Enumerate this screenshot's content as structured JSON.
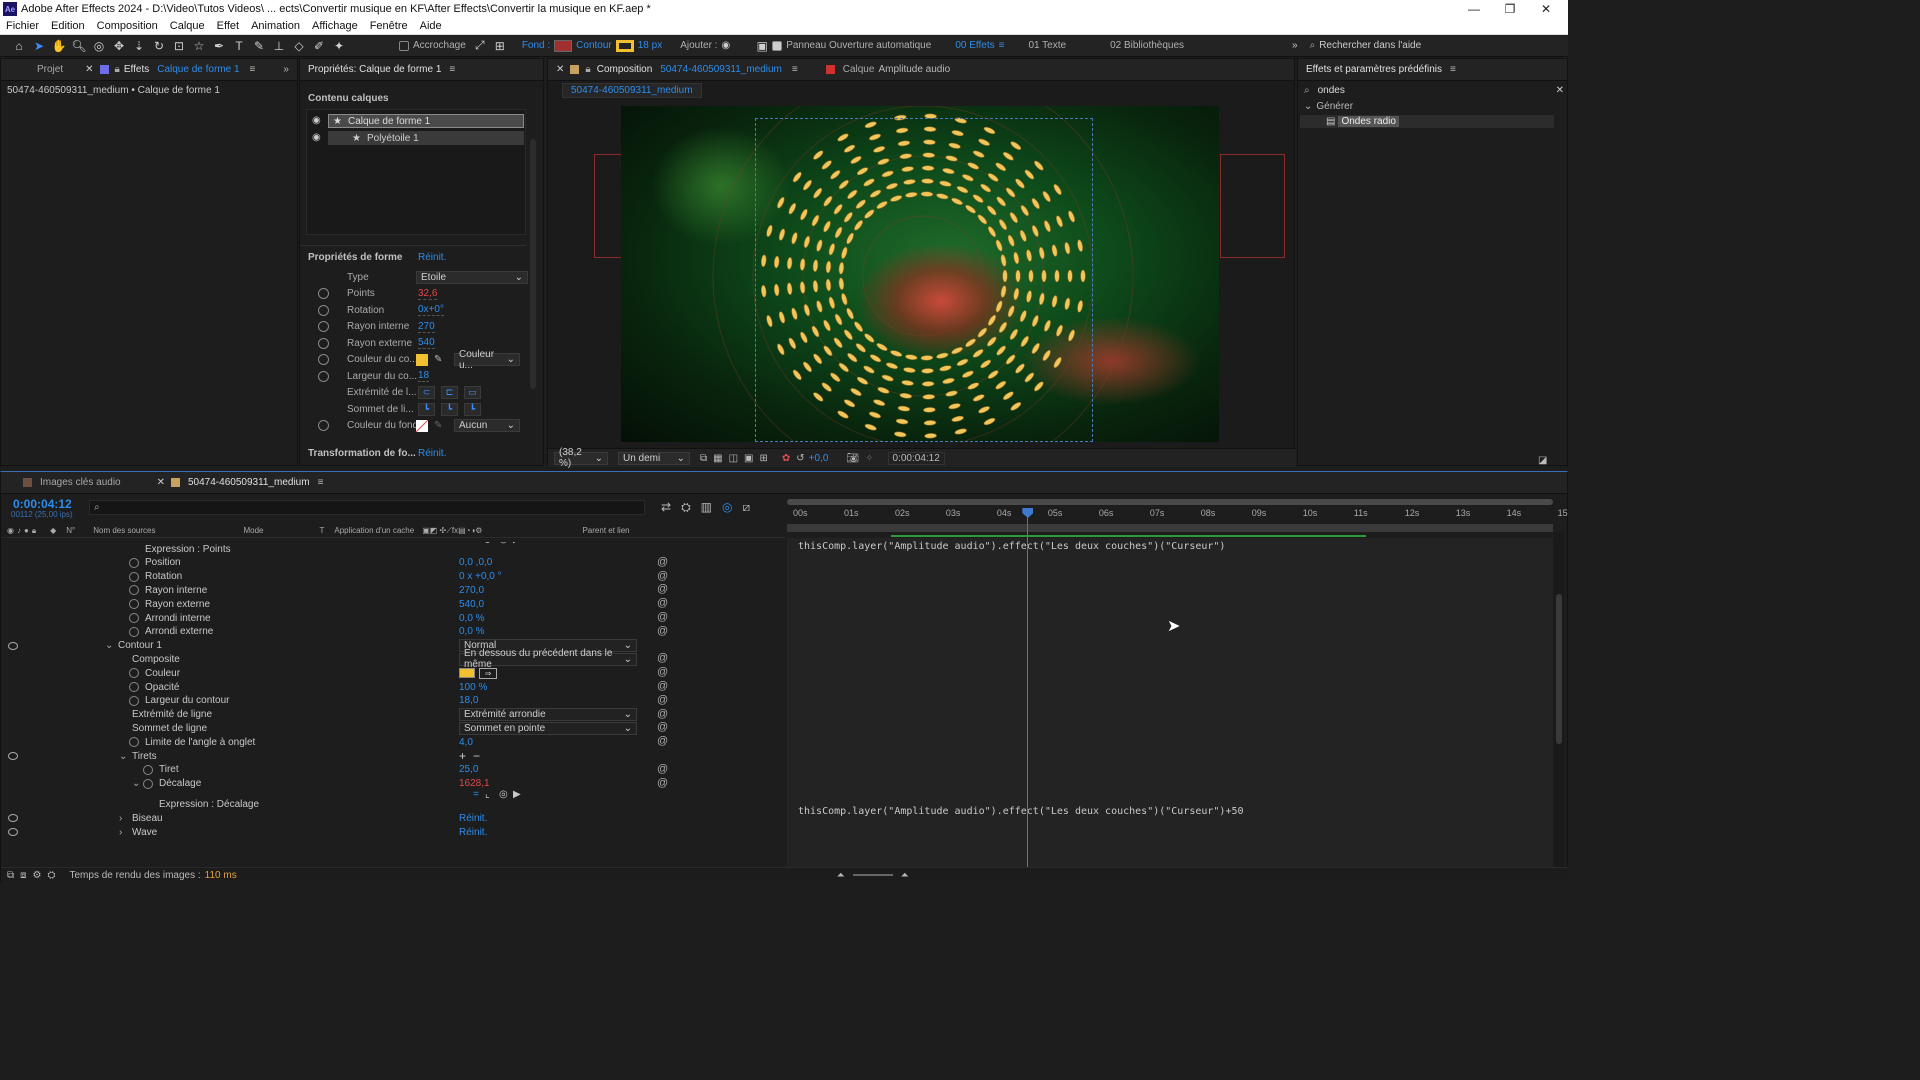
{
  "titlebar": {
    "title": "Adobe After Effects 2024 - D:\\Video\\Tutos Videos\\ ... ects\\Convertir musique en KF\\After Effects\\Convertir la musique en KF.aep *",
    "logo": "Ae"
  },
  "menu": [
    "Fichier",
    "Edition",
    "Composition",
    "Calque",
    "Effet",
    "Animation",
    "Affichage",
    "Fenêtre",
    "Aide"
  ],
  "toolbar": {
    "accrochage": "Accrochage",
    "fond": "Fond :",
    "contour": "Contour",
    "stroke_px": "18 px",
    "ajouter": "Ajouter :",
    "panneau": "Panneau Ouverture automatique",
    "effets": "00 Effets",
    "texte": "01 Texte",
    "bibliotheques": "02 Bibliothèques",
    "search_placeholder": "Rechercher dans l'aide",
    "fill_color": "#a03030",
    "stroke_color": "#f0c030"
  },
  "left_panel": {
    "tab_projet": "Projet",
    "tab_effets": "Effets",
    "tab_effets_layer": "Calque de forme 1",
    "breadcrumb": "50474-460509311_medium • Calque de forme 1"
  },
  "props_panel": {
    "title": "Propriétés: Calque de forme 1",
    "contenu": "Contenu calques",
    "layers": [
      "Calque de forme 1",
      "Polyétoile 1"
    ],
    "forme_title": "Propriétés de forme",
    "reinit": "Réinit.",
    "rows": [
      {
        "label": "Type",
        "value": "Etoile"
      },
      {
        "label": "Points",
        "value": "32,6"
      },
      {
        "label": "Rotation",
        "value": "0x+0°"
      },
      {
        "label": "Rayon interne",
        "value": "270"
      },
      {
        "label": "Rayon externe",
        "value": "540"
      },
      {
        "label": "Couleur du co...",
        "value": "Couleur u..."
      },
      {
        "label": "Largeur du co...",
        "value": "18"
      },
      {
        "label": "Extrémité de l...",
        "value": ""
      },
      {
        "label": "Sommet de li...",
        "value": ""
      },
      {
        "label": "Couleur du fond",
        "value": "Aucun"
      }
    ],
    "transform_title": "Transformation de fo...",
    "transform_reinit": "Réinit."
  },
  "comp_panel": {
    "tab": "Composition",
    "comp_name": "50474-460509311_medium",
    "layer_tab": "Calque",
    "layer_name": "Amplitude audio",
    "subtab": "50474-460509311_medium",
    "zoom": "(38,2 %)",
    "resolution": "Un demi",
    "exposure": "+0,0",
    "timecode": "0:00:04:12"
  },
  "effects_panel": {
    "title": "Effets et paramètres prédéfinis",
    "search": "ondes",
    "category": "Générer",
    "item": "Ondes radio"
  },
  "timeline": {
    "tab1": "Images clés audio",
    "tab2": "50474-460509311_medium",
    "timecode": "0:00:04:12",
    "frames": "00112 (25,00 ips)",
    "col_num": "N°",
    "col_source": "Nom des sources",
    "col_mode": "Mode",
    "col_t": "T",
    "col_cache": "Application d'un cache",
    "col_parent": "Parent et lien",
    "ruler": [
      "00s",
      "01s",
      "02s",
      "03s",
      "04s",
      "05s",
      "06s",
      "07s",
      "08s",
      "09s",
      "10s",
      "11s",
      "12s",
      "13s",
      "14s",
      "15"
    ],
    "playhead_s": 4.48,
    "rows": [
      {
        "label": "Expression : Points",
        "value": "",
        "indent": 144
      },
      {
        "label": "Position",
        "value": "0,0 ,0,0",
        "indent": 144
      },
      {
        "label": "Rotation",
        "value": "0 x +0,0 °",
        "indent": 144
      },
      {
        "label": "Rayon interne",
        "value": "270,0",
        "indent": 144
      },
      {
        "label": "Rayon externe",
        "value": "540,0",
        "indent": 144
      },
      {
        "label": "Arrondi interne",
        "value": "0,0 %",
        "indent": 144
      },
      {
        "label": "Arrondi externe",
        "value": "0,0 %",
        "indent": 144
      },
      {
        "label": "Contour 1",
        "value": "Normal",
        "indent": 117
      },
      {
        "label": "Composite",
        "value": "En dessous du précédent dans le même",
        "indent": 131
      },
      {
        "label": "Couleur",
        "value": "",
        "indent": 144
      },
      {
        "label": "Opacité",
        "value": "100 %",
        "indent": 144
      },
      {
        "label": "Largeur du contour",
        "value": "18,0",
        "indent": 144
      },
      {
        "label": "Extrémité de ligne",
        "value": "Extrémité arrondie",
        "indent": 131
      },
      {
        "label": "Sommet de ligne",
        "value": "Sommet en pointe",
        "indent": 131
      },
      {
        "label": "Limite de l'angle à onglet",
        "value": "4,0",
        "indent": 144
      },
      {
        "label": "Tirets",
        "value": "",
        "indent": 131
      },
      {
        "label": "Tiret",
        "value": "25,0",
        "indent": 158
      },
      {
        "label": "Décalage",
        "value": "1628,1",
        "indent": 158
      },
      {
        "label": "Expression : Décalage",
        "value": "",
        "indent": 158
      },
      {
        "label": "Biseau",
        "value": "Réinit.",
        "indent": 131
      },
      {
        "label": "Wave",
        "value": "Réinit.",
        "indent": 131
      }
    ],
    "expr1": "thisComp.layer(\"Amplitude audio\").effect(\"Les deux couches\")(\"Curseur\")",
    "expr2": "thisComp.layer(\"Amplitude audio\").effect(\"Les deux couches\")(\"Curseur\")+50",
    "render_label": "Temps de rendu des images :",
    "render_value": "110 ms"
  }
}
